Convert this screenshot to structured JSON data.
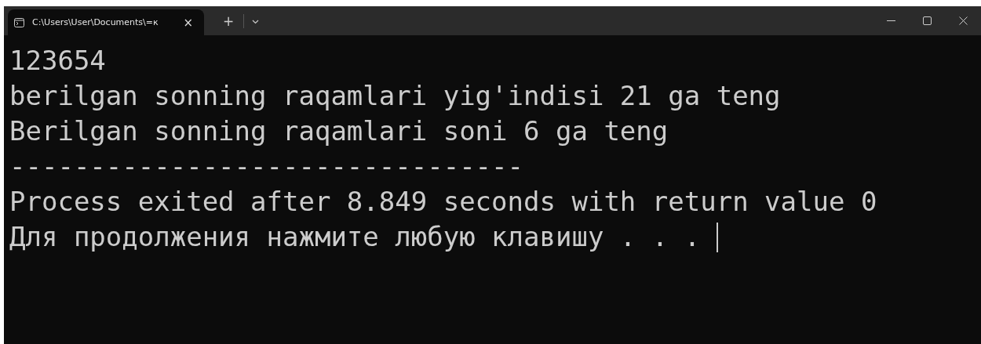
{
  "window": {
    "tab_title": "C:\\Users\\User\\Documents\\=к",
    "tab_close": "×",
    "new_tab": "+"
  },
  "console": {
    "lines": [
      "123654",
      "berilgan sonning raqamlari yig'indisi 21 ga teng",
      "Berilgan sonning raqamlari soni 6 ga teng",
      "--------------------------------",
      "Process exited after 8.849 seconds with return value 0",
      "Для продолжения нажмите любую клавишу . . . "
    ]
  }
}
